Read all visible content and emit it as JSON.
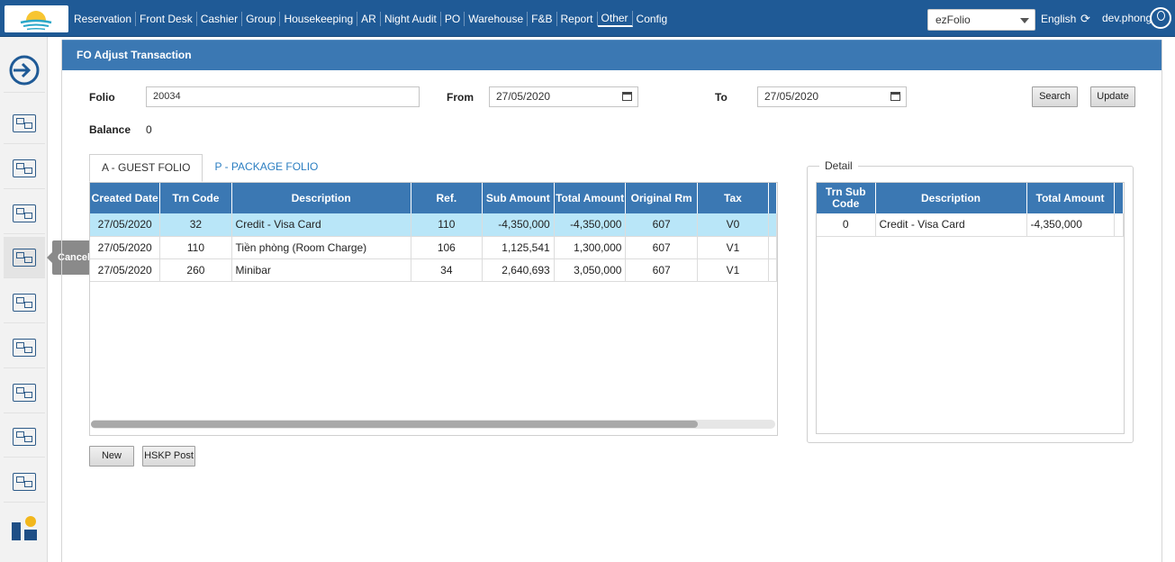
{
  "nav": {
    "items": [
      "Reservation",
      "Front Desk",
      "Cashier",
      "Group",
      "Housekeeping",
      "AR",
      "Night Audit",
      "PO",
      "Warehouse",
      "F&B",
      "Report",
      "Other",
      "Config"
    ],
    "active": "Other",
    "folio_select": "ezFolio",
    "language": "English",
    "username": "dev.phong"
  },
  "sidebar": {
    "tooltip": "Cancel Check-In",
    "icons": [
      "sign-in-icon",
      "room-plan-icon",
      "checkin-icon",
      "room-move-icon",
      "cancel-checkin-icon",
      "room-search-icon",
      "billing-icon",
      "room-change-icon",
      "calculator-icon",
      "cashier-icon",
      "brand-logo-icon"
    ]
  },
  "panel": {
    "title": "FO Adjust Transaction"
  },
  "form": {
    "folio_label": "Folio",
    "folio_value": "20034",
    "from_label": "From",
    "from_value": "27/05/2020",
    "to_label": "To",
    "to_value": "27/05/2020",
    "search_label": "Search",
    "update_label": "Update",
    "balance_label": "Balance",
    "balance_value": "0"
  },
  "tabs": [
    "A - GUEST FOLIO",
    "P - PACKAGE FOLIO"
  ],
  "grid": {
    "headers": [
      "Created Date",
      "Trn Code",
      "Description",
      "Ref.",
      "Sub Amount",
      "Total Amount",
      "Original Rm",
      "Tax"
    ],
    "rows": [
      [
        "27/05/2020",
        "32",
        "Credit - Visa Card",
        "110",
        "-4,350,000",
        "-4,350,000",
        "607",
        "V0"
      ],
      [
        "27/05/2020",
        "110",
        "Tiền phòng (Room Charge)",
        "106",
        "1,125,541",
        "1,300,000",
        "607",
        "V1"
      ],
      [
        "27/05/2020",
        "260",
        "Minibar",
        "34",
        "2,640,693",
        "3,050,000",
        "607",
        "V1"
      ]
    ]
  },
  "buttons": {
    "new_label": "New",
    "hskp_label": "HSKP Post"
  },
  "detail": {
    "legend": "Detail",
    "headers": [
      "Trn Sub Code",
      "Description",
      "Total Amount"
    ],
    "rows": [
      [
        "0",
        "Credit - Visa Card",
        "-4,350,000"
      ]
    ]
  }
}
